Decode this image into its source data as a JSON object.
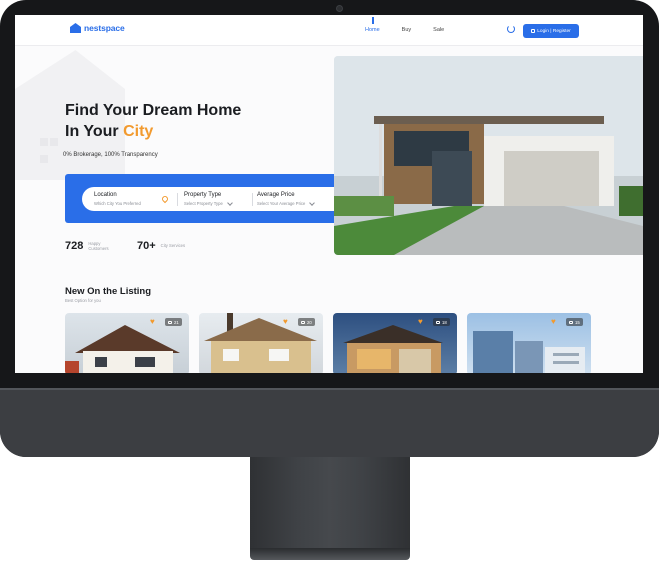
{
  "nav": {
    "logo": "nestspace",
    "links": [
      "Home",
      "Buy",
      "Sale"
    ],
    "active_link": "Home",
    "login_label": "Login | Register"
  },
  "hero": {
    "title_line1": "Find Your Dream Home",
    "title_line2_prefix": "In Your ",
    "title_line2_accent": "City",
    "tagline": "0% Brokerage, 100% Transparency"
  },
  "search": {
    "location_title": "Location",
    "location_sub": "Which City You Preferred",
    "type_title": "Property Type",
    "type_sub": "Select Property Type",
    "price_title": "Average Price",
    "price_sub": "Select Your Average Price"
  },
  "stats": [
    {
      "value": "728",
      "label": "Happy Customers"
    },
    {
      "value": "70+",
      "label": "City Services"
    }
  ],
  "listings": {
    "title": "New On the Listing",
    "subtitle": "Best Option for you",
    "cards": [
      {
        "photos": "21"
      },
      {
        "photos": "20"
      },
      {
        "photos": "18"
      },
      {
        "photos": "15"
      }
    ]
  },
  "colors": {
    "brand": "#2a6ee8",
    "accent": "#f29a2e",
    "bezel": "#161719"
  }
}
